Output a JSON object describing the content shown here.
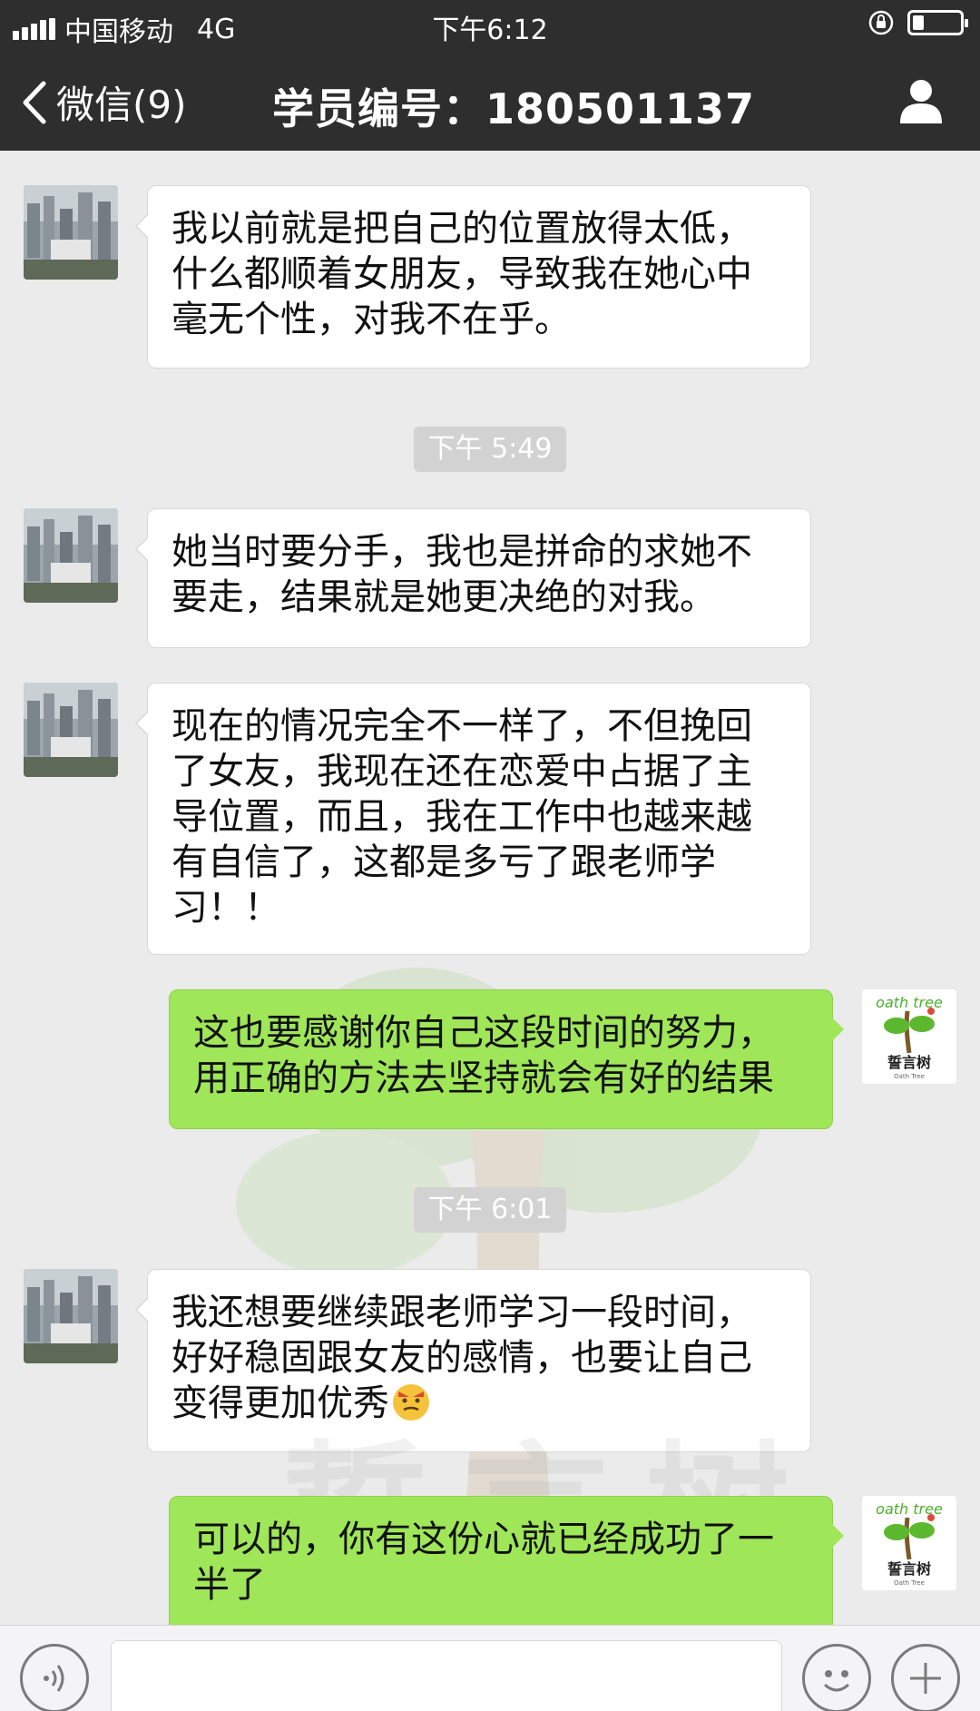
{
  "status_bar": {
    "carrier": "中国移动",
    "network": "4G",
    "time": "下午6:12"
  },
  "nav": {
    "back_label": "微信(9)",
    "title": "学员编号：180501137"
  },
  "messages": [
    {
      "side": "in",
      "text": "我以前就是把自己的位置放得太低，什么都顺着女朋友，导致我在她心中毫无个性，对我不在乎。"
    },
    {
      "type": "time",
      "text": "下午 5:49"
    },
    {
      "side": "in",
      "text": "她当时要分手，我也是拼命的求她不要走，结果就是她更决绝的对我。"
    },
    {
      "side": "in",
      "text": "现在的情况完全不一样了，不但挽回了女友，我现在还在恋爱中占据了主导位置，而且，我在工作中也越来越有自信了，这都是多亏了跟老师学习！！"
    },
    {
      "side": "out",
      "text": "这也要感谢你自己这段时间的努力，用正确的方法去坚持就会有好的结果"
    },
    {
      "type": "time",
      "text": "下午 6:01"
    },
    {
      "side": "in",
      "text": "我还想要继续跟老师学习一段时间，好好稳固跟女友的感情，也要让自己变得更加优秀"
    },
    {
      "side": "out",
      "text": "可以的，你有这份心就已经成功了一半了"
    }
  ],
  "avatar_logo": {
    "word": "oath tree",
    "brand": "誓言树",
    "sub": "Oath Tree"
  },
  "watermark": {
    "text": "誓言树"
  },
  "colors": {
    "header_bg": "#2e2e2e",
    "chat_bg": "#ebebeb",
    "bubble_out": "#9fe658",
    "bubble_in": "#ffffff",
    "brand_green": "#4caf2a"
  },
  "icons": {
    "back": "chevron-left-icon",
    "profile": "person-icon",
    "voice": "voice-icon",
    "emoji": "smiley-icon",
    "plus": "plus-icon",
    "lock": "rotation-lock-icon"
  }
}
